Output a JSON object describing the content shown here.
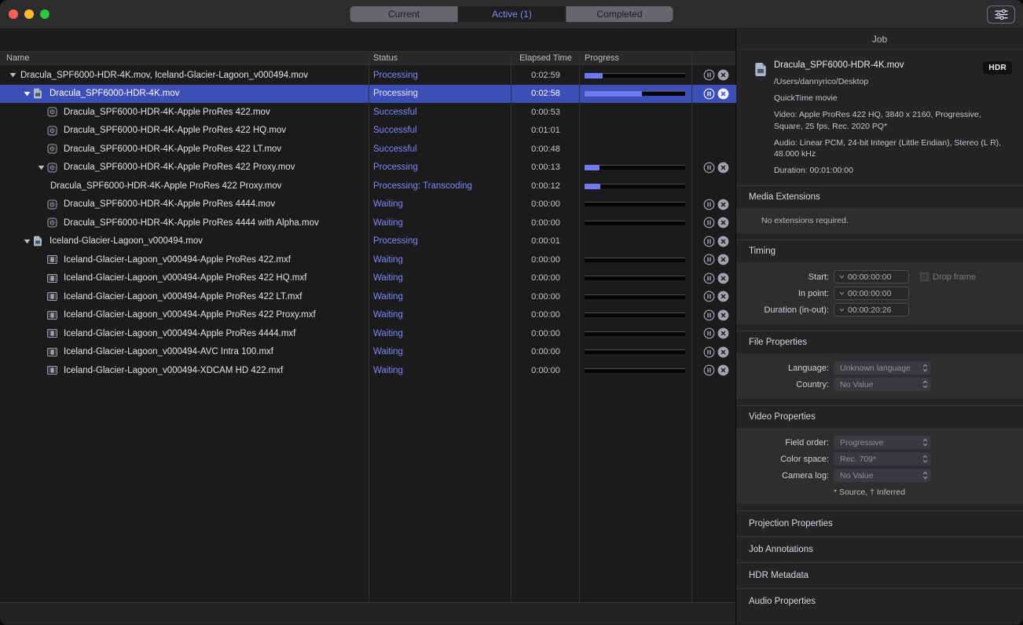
{
  "colors": {
    "accent": "#7d88f5",
    "selection": "#3c4eb7",
    "progress": "#6f7aee",
    "traffic-close": "#ff5f57",
    "traffic-min": "#febc2e",
    "traffic-zoom": "#28c840"
  },
  "titlebar": {
    "tabs": [
      {
        "label": "Current",
        "active": false
      },
      {
        "label": "Active (1)",
        "active": true
      },
      {
        "label": "Completed",
        "active": false
      }
    ],
    "filter_button": "batch-filter"
  },
  "table": {
    "columns": {
      "name": "Name",
      "status": "Status",
      "elapsed": "Elapsed Time",
      "progress": "Progress"
    },
    "rows": [
      {
        "indent": 0,
        "disclosure": true,
        "icon": null,
        "name": "Dracula_SPF6000-HDR-4K.mov, Iceland-Glacier-Lagoon_v000494.mov",
        "status": "Processing",
        "elapsed": "0:02:59",
        "progress": 18,
        "actions": true,
        "selected": false
      },
      {
        "indent": 1,
        "disclosure": true,
        "icon": "movie-icon",
        "name": "Dracula_SPF6000-HDR-4K.mov",
        "status": "Processing",
        "elapsed": "0:02:58",
        "progress": 57,
        "actions": true,
        "selected": true
      },
      {
        "indent": 2,
        "disclosure": false,
        "icon": "output-icon",
        "name": "Dracula_SPF6000-HDR-4K-Apple ProRes 422.mov",
        "status": "Successful",
        "elapsed": "0:00:53",
        "progress": null,
        "actions": false,
        "selected": false
      },
      {
        "indent": 2,
        "disclosure": false,
        "icon": "output-icon",
        "name": "Dracula_SPF6000-HDR-4K-Apple ProRes 422 HQ.mov",
        "status": "Successful",
        "elapsed": "0:01:01",
        "progress": null,
        "actions": false,
        "selected": false
      },
      {
        "indent": 2,
        "disclosure": false,
        "icon": "output-icon",
        "name": "Dracula_SPF6000-HDR-4K-Apple ProRes 422 LT.mov",
        "status": "Successful",
        "elapsed": "0:00:48",
        "progress": null,
        "actions": false,
        "selected": false
      },
      {
        "indent": 2,
        "disclosure": true,
        "icon": "output-icon",
        "name": "Dracula_SPF6000-HDR-4K-Apple ProRes 422 Proxy.mov",
        "status": "Processing",
        "elapsed": "0:00:13",
        "progress": 15,
        "actions": true,
        "selected": false
      },
      {
        "indent": 3,
        "disclosure": false,
        "icon": null,
        "name": "Dracula_SPF6000-HDR-4K-Apple ProRes 422 Proxy.mov",
        "status": "Processing: Transcoding",
        "elapsed": "0:00:12",
        "progress": 16,
        "actions": false,
        "selected": false
      },
      {
        "indent": 2,
        "disclosure": false,
        "icon": "output-icon",
        "name": "Dracula_SPF6000-HDR-4K-Apple ProRes 4444.mov",
        "status": "Waiting",
        "elapsed": "0:00:00",
        "progress": 0,
        "actions": true,
        "selected": false
      },
      {
        "indent": 2,
        "disclosure": false,
        "icon": "output-icon",
        "name": "Dracula_SPF6000-HDR-4K-Apple ProRes 4444 with Alpha.mov",
        "status": "Waiting",
        "elapsed": "0:00:00",
        "progress": 0,
        "actions": true,
        "selected": false
      },
      {
        "indent": 1,
        "disclosure": true,
        "icon": "movie-icon",
        "name": "Iceland-Glacier-Lagoon_v000494.mov",
        "status": "Processing",
        "elapsed": "0:00:01",
        "progress": null,
        "actions": true,
        "selected": false
      },
      {
        "indent": 2,
        "disclosure": false,
        "icon": "film-icon",
        "name": "Iceland-Glacier-Lagoon_v000494-Apple ProRes 422.mxf",
        "status": "Waiting",
        "elapsed": "0:00:00",
        "progress": 0,
        "actions": true,
        "selected": false
      },
      {
        "indent": 2,
        "disclosure": false,
        "icon": "film-icon",
        "name": "Iceland-Glacier-Lagoon_v000494-Apple ProRes 422 HQ.mxf",
        "status": "Waiting",
        "elapsed": "0:00:00",
        "progress": 0,
        "actions": true,
        "selected": false
      },
      {
        "indent": 2,
        "disclosure": false,
        "icon": "film-icon",
        "name": "Iceland-Glacier-Lagoon_v000494-Apple ProRes 422 LT.mxf",
        "status": "Waiting",
        "elapsed": "0:00:00",
        "progress": 0,
        "actions": true,
        "selected": false
      },
      {
        "indent": 2,
        "disclosure": false,
        "icon": "film-icon",
        "name": "Iceland-Glacier-Lagoon_v000494-Apple ProRes 422 Proxy.mxf",
        "status": "Waiting",
        "elapsed": "0:00:00",
        "progress": 0,
        "actions": true,
        "selected": false
      },
      {
        "indent": 2,
        "disclosure": false,
        "icon": "film-icon",
        "name": "Iceland-Glacier-Lagoon_v000494-Apple ProRes 4444.mxf",
        "status": "Waiting",
        "elapsed": "0:00:00",
        "progress": 0,
        "actions": true,
        "selected": false
      },
      {
        "indent": 2,
        "disclosure": false,
        "icon": "film-icon",
        "name": "Iceland-Glacier-Lagoon_v000494-AVC Intra 100.mxf",
        "status": "Waiting",
        "elapsed": "0:00:00",
        "progress": 0,
        "actions": true,
        "selected": false
      },
      {
        "indent": 2,
        "disclosure": false,
        "icon": "film-icon",
        "name": "Iceland-Glacier-Lagoon_v000494-XDCAM HD 422.mxf",
        "status": "Waiting",
        "elapsed": "0:00:00",
        "progress": 0,
        "actions": true,
        "selected": false
      }
    ]
  },
  "inspector": {
    "title": "Job",
    "file": {
      "name": "Dracula_SPF6000-HDR-4K.mov",
      "badge": "HDR",
      "path": "/Users/dannyrico/Desktop",
      "kind": "QuickTime movie",
      "video": "Video: Apple ProRes 422 HQ, 3840 x 2160, Progressive, Square, 25 fps, Rec. 2020 PQ*",
      "audio": "Audio: Linear PCM, 24-bit Integer (Little Endian), Stereo (L R), 48.000 kHz",
      "duration": "Duration: 00:01:00:00"
    },
    "media_extensions": {
      "header": "Media Extensions",
      "body": "No extensions required."
    },
    "timing": {
      "header": "Timing",
      "drop_frame_label": "Drop frame",
      "rows": [
        {
          "label": "Start:",
          "value": "00:00:00:00"
        },
        {
          "label": "In point:",
          "value": "00:00:00:00"
        },
        {
          "label": "Duration (in-out):",
          "value": "00:00:20:26"
        }
      ]
    },
    "file_properties": {
      "header": "File Properties",
      "rows": [
        {
          "label": "Language:",
          "value": "Unknown language"
        },
        {
          "label": "Country:",
          "value": "No Value"
        }
      ]
    },
    "video_properties": {
      "header": "Video Properties",
      "rows": [
        {
          "label": "Field order:",
          "value": "Progressive"
        },
        {
          "label": "Color space:",
          "value": "Rec. 709*"
        },
        {
          "label": "Camera log:",
          "value": "No Value"
        }
      ],
      "footnote": "* Source, † Inferred"
    },
    "sections": [
      "Projection Properties",
      "Job Annotations",
      "HDR Metadata",
      "Audio Properties"
    ]
  }
}
